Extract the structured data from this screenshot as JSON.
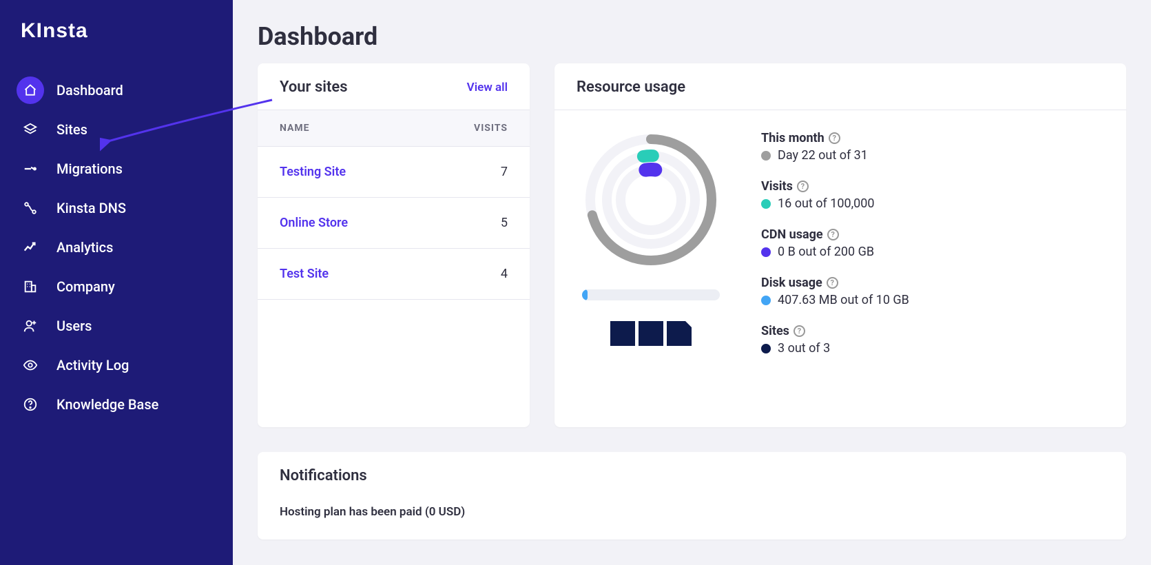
{
  "brand": "KInsta",
  "page_title": "Dashboard",
  "sidebar": {
    "items": [
      {
        "label": "Dashboard",
        "icon": "home",
        "active": true
      },
      {
        "label": "Sites",
        "icon": "layers"
      },
      {
        "label": "Migrations",
        "icon": "migrate"
      },
      {
        "label": "Kinsta DNS",
        "icon": "dns"
      },
      {
        "label": "Analytics",
        "icon": "analytics"
      },
      {
        "label": "Company",
        "icon": "company"
      },
      {
        "label": "Users",
        "icon": "users"
      },
      {
        "label": "Activity Log",
        "icon": "eye"
      },
      {
        "label": "Knowledge Base",
        "icon": "help"
      }
    ]
  },
  "sites_card": {
    "title": "Your sites",
    "view_all": "View all",
    "columns": {
      "name": "NAME",
      "visits": "VISITS"
    },
    "rows": [
      {
        "name": "Testing Site",
        "visits": "7"
      },
      {
        "name": "Online Store",
        "visits": "5"
      },
      {
        "name": "Test Site",
        "visits": "4"
      }
    ]
  },
  "resource_card": {
    "title": "Resource usage",
    "legend": {
      "month": {
        "title": "This month",
        "value": "Day 22 out of 31",
        "dot": "#9e9e9e"
      },
      "visits": {
        "title": "Visits",
        "value": "16 out of 100,000",
        "dot": "#29cdb8"
      },
      "cdn": {
        "title": "CDN usage",
        "value": "0 B out of 200 GB",
        "dot": "#5333ed"
      },
      "disk": {
        "title": "Disk usage",
        "value": "407.63 MB out of 10 GB",
        "dot": "#42a5f5"
      },
      "sites": {
        "title": "Sites",
        "value": "3 out of 3",
        "dot": "#0d1b4c"
      }
    }
  },
  "chart_data": {
    "type": "pie",
    "title": "Resource usage gauges",
    "series": [
      {
        "name": "This month",
        "value": 22,
        "max": 31,
        "pct": 70.97,
        "color": "#9e9e9e"
      },
      {
        "name": "Visits",
        "value": 16,
        "max": 100000,
        "pct": 0.016,
        "color": "#29cdb8"
      },
      {
        "name": "CDN usage",
        "value": 0,
        "max": 200,
        "pct": 0.0,
        "unit": "GB",
        "color": "#5333ed"
      },
      {
        "name": "Disk usage",
        "value": 407.63,
        "max": 10240,
        "pct": 3.98,
        "unit": "MB",
        "color": "#42a5f5"
      },
      {
        "name": "Sites",
        "value": 3,
        "max": 3,
        "pct": 100.0,
        "color": "#0d1b4c"
      }
    ]
  },
  "notifications": {
    "title": "Notifications",
    "items": [
      {
        "text": "Hosting plan has been paid (0 USD)"
      }
    ]
  }
}
